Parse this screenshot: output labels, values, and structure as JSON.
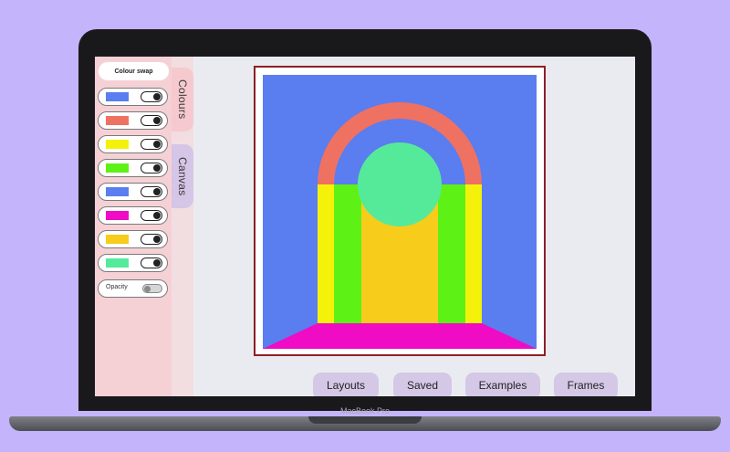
{
  "device": {
    "brand_label": "MacBook Pro"
  },
  "sidebar": {
    "header_label": "Colour swap",
    "color_rows": [
      {
        "color": "#5a7df0",
        "enabled": true
      },
      {
        "color": "#ef7162",
        "enabled": true
      },
      {
        "color": "#f4f20a",
        "enabled": true
      },
      {
        "color": "#5ef116",
        "enabled": true
      },
      {
        "color": "#5a7df0",
        "enabled": true
      },
      {
        "color": "#f00bc4",
        "enabled": true
      },
      {
        "color": "#f7cc1b",
        "enabled": true
      },
      {
        "color": "#55ea9a",
        "enabled": true
      }
    ],
    "opacity_label": "Opacity",
    "opacity_enabled": false
  },
  "tabs": {
    "colours_label": "Colours",
    "canvas_label": "Canvas"
  },
  "artwork": {
    "colors": {
      "background": "#5a7df0",
      "arch": "#ef7162",
      "pillar_outer": "#f4f20a",
      "pillar_inner": "#5ef116",
      "inner_fill": "#5a7df0",
      "floor": "#f00bc4",
      "path": "#f7cc1b",
      "orb": "#55ea9a"
    },
    "frame_color": "#8c1f24"
  },
  "bottom_nav": {
    "layouts_label": "Layouts",
    "saved_label": "Saved",
    "examples_label": "Examples",
    "frames_label": "Frames"
  }
}
